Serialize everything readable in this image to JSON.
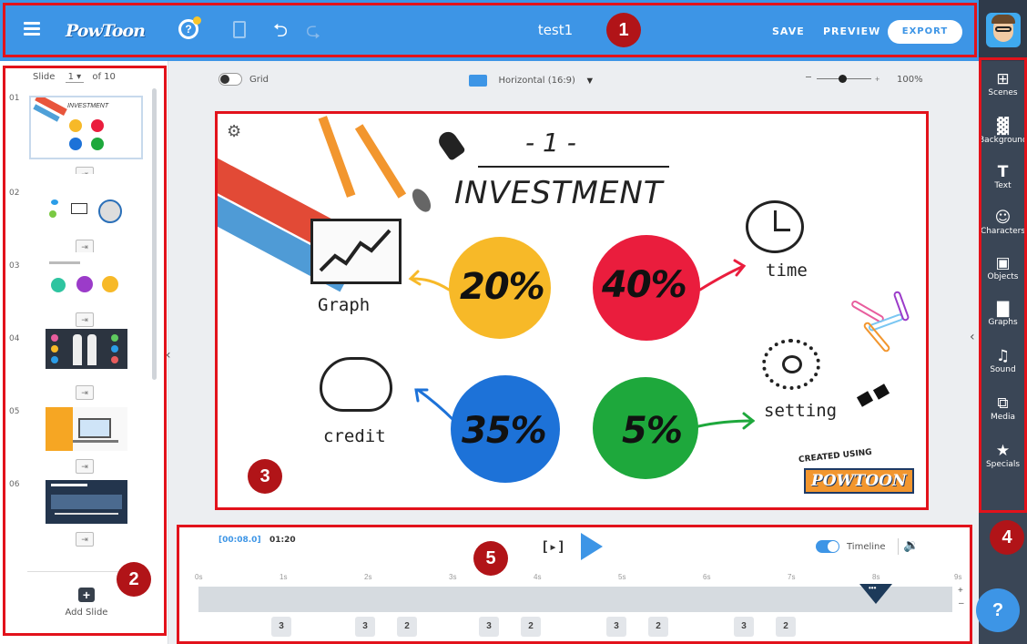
{
  "header": {
    "logo": "PowToon",
    "title": "test1",
    "save_label": "SAVE",
    "preview_label": "PREVIEW",
    "export_label": "EXPORT",
    "icons": [
      "menu-icon",
      "help-bulb-icon",
      "notes-icon",
      "undo-icon",
      "redo-icon"
    ]
  },
  "slides_panel": {
    "slide_label": "Slide",
    "current_slide": "1",
    "of_label": "of 10",
    "thumbnails": [
      {
        "num": "01",
        "title": "INVESTMENT"
      },
      {
        "num": "02"
      },
      {
        "num": "03"
      },
      {
        "num": "04"
      },
      {
        "num": "05"
      },
      {
        "num": "06"
      }
    ],
    "add_slide_label": "Add Slide"
  },
  "canvas_toolbar": {
    "grid_label": "Grid",
    "aspect_label": "Horizontal (16:9)",
    "zoom_label": "100%"
  },
  "slide": {
    "number": "- 1 -",
    "title": "INVESTMENT",
    "items": [
      {
        "percent": "20%",
        "label": "Graph",
        "color": "#f7b928"
      },
      {
        "percent": "40%",
        "label": "time",
        "color": "#ea1d3d"
      },
      {
        "percent": "35%",
        "label": "credit",
        "color": "#1d72d8"
      },
      {
        "percent": "5%",
        "label": "setting",
        "color": "#1ea83c"
      }
    ],
    "watermark": "CREATED USING",
    "watermark_logo": "POWTOON"
  },
  "right_toolbar": {
    "items": [
      {
        "label": "Scenes",
        "icon": "scenes-icon"
      },
      {
        "label": "Background",
        "icon": "background-icon"
      },
      {
        "label": "Text",
        "icon": "text-icon"
      },
      {
        "label": "Characters",
        "icon": "characters-icon"
      },
      {
        "label": "Objects",
        "icon": "objects-icon"
      },
      {
        "label": "Graphs",
        "icon": "graphs-icon"
      },
      {
        "label": "Sound",
        "icon": "sound-icon"
      },
      {
        "label": "Media",
        "icon": "media-icon"
      },
      {
        "label": "Specials",
        "icon": "specials-icon"
      }
    ],
    "help_label": "?"
  },
  "timeline": {
    "current_time": "[00:08.0]",
    "total_time": "01:20",
    "toggle_label": "Timeline",
    "ticks": [
      "0s",
      "1s",
      "2s",
      "3s",
      "4s",
      "5s",
      "6s",
      "7s",
      "8s",
      "9s"
    ],
    "chips": [
      "3",
      "3",
      "2",
      "3",
      "2",
      "3",
      "2",
      "3",
      "2"
    ],
    "marker_label": "•••"
  },
  "annotations": [
    "1",
    "2",
    "3",
    "4",
    "5"
  ],
  "colors": {
    "topbar": "#3d95e6",
    "sidebar_dark": "#3a4656",
    "annotation_red": "#e2121b",
    "badge_red": "#b11418",
    "play_blue": "#3d95e6"
  }
}
